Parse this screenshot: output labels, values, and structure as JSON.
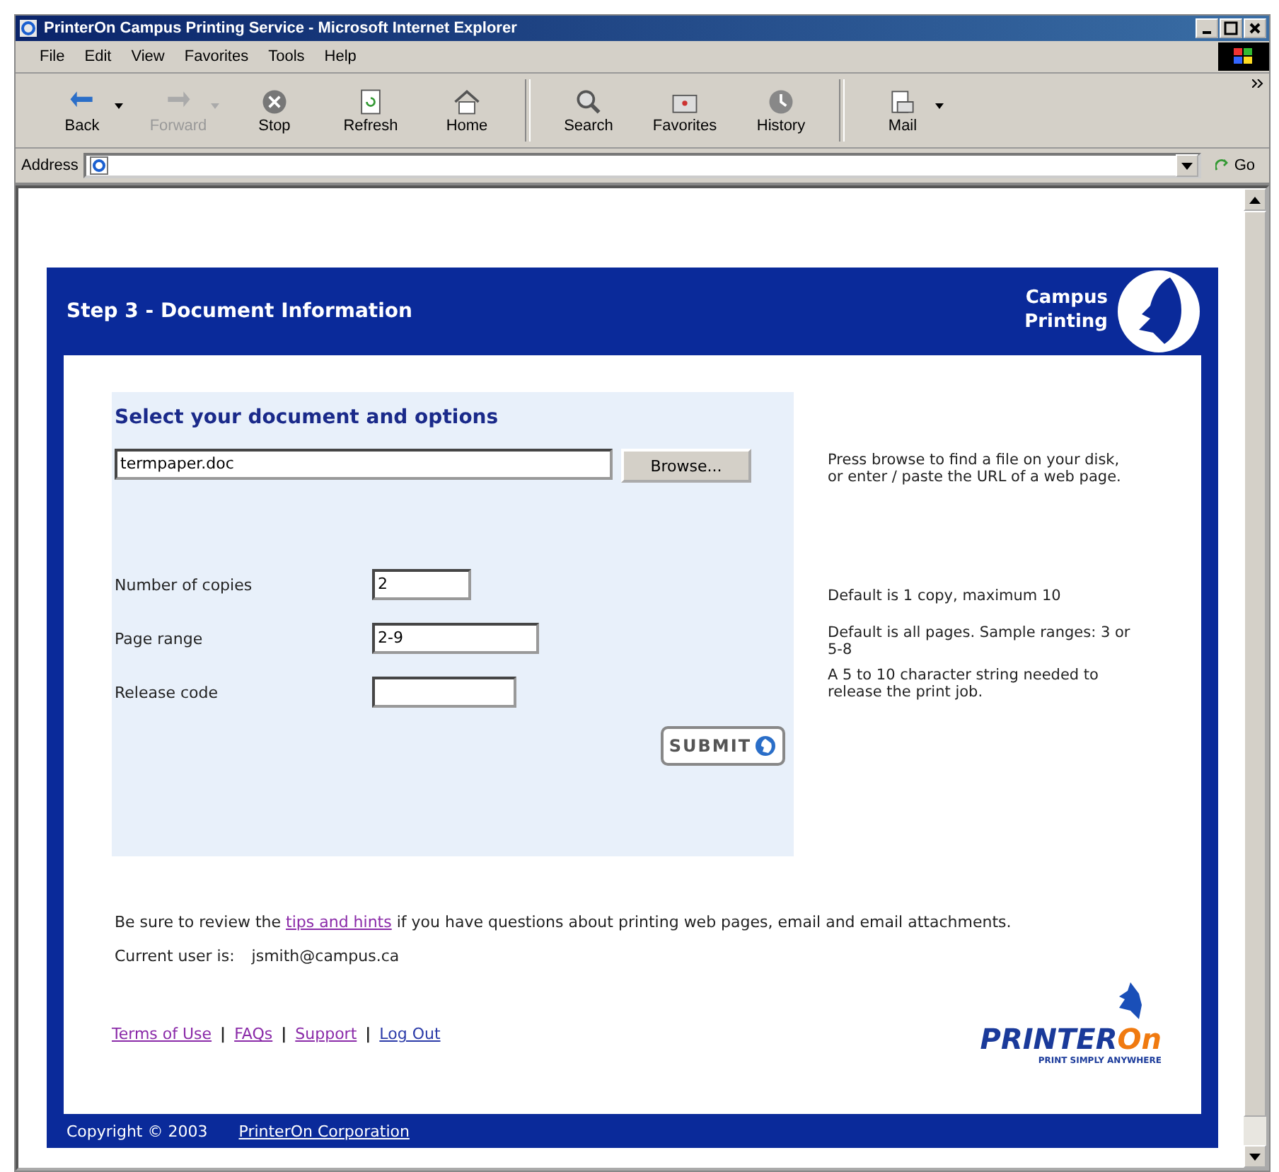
{
  "window": {
    "title": "PrinterOn Campus Printing Service - Microsoft Internet Explorer"
  },
  "menu": [
    {
      "label": "File"
    },
    {
      "label": "Edit"
    },
    {
      "label": "View"
    },
    {
      "label": "Favorites"
    },
    {
      "label": "Tools"
    },
    {
      "label": "Help"
    }
  ],
  "toolbar": [
    {
      "label": "Back",
      "kind": "back",
      "disabled": false,
      "dropdown": true
    },
    {
      "label": "Forward",
      "kind": "forward",
      "disabled": true,
      "dropdown": true
    },
    {
      "label": "Stop",
      "kind": "stop",
      "disabled": false,
      "dropdown": false
    },
    {
      "label": "Refresh",
      "kind": "refresh",
      "disabled": false,
      "dropdown": false
    },
    {
      "label": "Home",
      "kind": "home",
      "disabled": false,
      "dropdown": false
    },
    {
      "label": "Search",
      "kind": "search",
      "disabled": false,
      "dropdown": false
    },
    {
      "label": "Favorites",
      "kind": "favorites",
      "disabled": false,
      "dropdown": false
    },
    {
      "label": "History",
      "kind": "history",
      "disabled": false,
      "dropdown": false
    },
    {
      "label": "Mail",
      "kind": "mail",
      "disabled": false,
      "dropdown": true
    }
  ],
  "address": {
    "label": "Address",
    "go": "Go"
  },
  "page": {
    "header": "Step 3 - Document Information",
    "brand": [
      "Campus",
      "Printing"
    ],
    "form": {
      "title": "Select your document and options",
      "file": "termpaper.doc",
      "browse": "Browse...",
      "fields": [
        {
          "label": "Number of copies",
          "value": "2"
        },
        {
          "label": "Page range",
          "value": "2-9"
        },
        {
          "label": "Release code"
        }
      ],
      "submit": "SUBMIT"
    },
    "help": [
      "Press browse to find a file on your disk, or enter / paste the URL of a web page.",
      "Default is 1 copy, maximum 10",
      "Default is all pages. Sample ranges: 3 or 5-8",
      "A 5 to 10 character string needed to release the print job."
    ],
    "review": {
      "before": "Be sure to review the",
      "link": "tips and hints",
      "after": "if you have questions about printing web pages, email and email attachments."
    },
    "user": {
      "label": "Current user is:",
      "value": "jsmith@campus.ca"
    },
    "link_separator": "|",
    "links": [
      {
        "label": "Terms of Use",
        "visited": true
      },
      {
        "label": "FAQs",
        "visited": true
      },
      {
        "label": "Support",
        "visited": true
      },
      {
        "label": "Log Out",
        "visited": false
      }
    ],
    "logo": {
      "name": "PRINTER",
      "accent": "On",
      "tagline": "PRINT SIMPLY ANYWHERE"
    },
    "footer": {
      "copyright": "Copyright © 2003",
      "company": "PrinterOn Corporation"
    }
  }
}
